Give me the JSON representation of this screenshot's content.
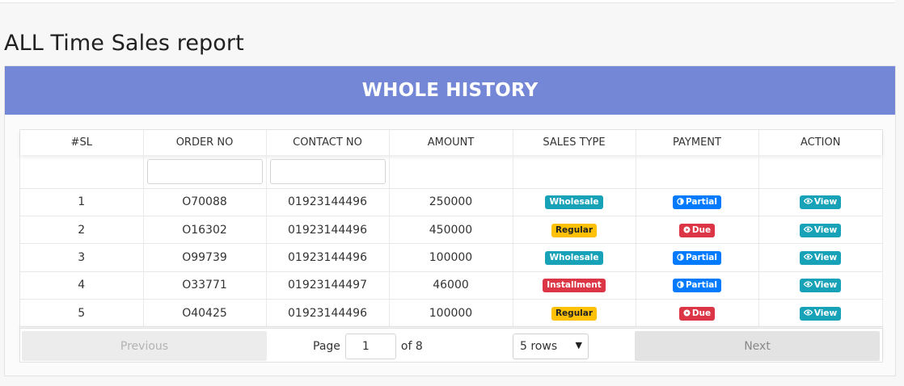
{
  "page": {
    "title": "ALL Time Sales report"
  },
  "card": {
    "header": "WHOLE HISTORY"
  },
  "table": {
    "columns": [
      "#SL",
      "ORDER NO",
      "CONTACT NO",
      "AMOUNT",
      "SALES TYPE",
      "PAYMENT",
      "ACTION"
    ],
    "filters": {
      "order_no": "",
      "contact_no": ""
    },
    "rows": [
      {
        "sl": "1",
        "order_no": "O70088",
        "contact_no": "01923144496",
        "amount": "250000",
        "sales_type": "Wholesale",
        "payment": "Partial",
        "action": "View"
      },
      {
        "sl": "2",
        "order_no": "O16302",
        "contact_no": "01923144496",
        "amount": "450000",
        "sales_type": "Regular",
        "payment": "Due",
        "action": "View"
      },
      {
        "sl": "3",
        "order_no": "O99739",
        "contact_no": "01923144496",
        "amount": "100000",
        "sales_type": "Wholesale",
        "payment": "Partial",
        "action": "View"
      },
      {
        "sl": "4",
        "order_no": "O33771",
        "contact_no": "01923144497",
        "amount": "46000",
        "sales_type": "Installment",
        "payment": "Partial",
        "action": "View"
      },
      {
        "sl": "5",
        "order_no": "O40425",
        "contact_no": "01923144496",
        "amount": "100000",
        "sales_type": "Regular",
        "payment": "Due",
        "action": "View"
      }
    ]
  },
  "pagination": {
    "previous_label": "Previous",
    "next_label": "Next",
    "page_label": "Page",
    "current_page": "1",
    "of_label": "of 8",
    "rows_option": "5 rows"
  },
  "colors": {
    "header_bg": "#7387d6",
    "wholesale": "#17a2b8",
    "regular": "#ffc107",
    "installment": "#dc3545",
    "partial": "#007bff",
    "due": "#dc3545",
    "view": "#17a2b8"
  },
  "icons": {
    "partial": "half-circle-icon",
    "due": "play-circle-icon",
    "view": "eye-icon"
  }
}
